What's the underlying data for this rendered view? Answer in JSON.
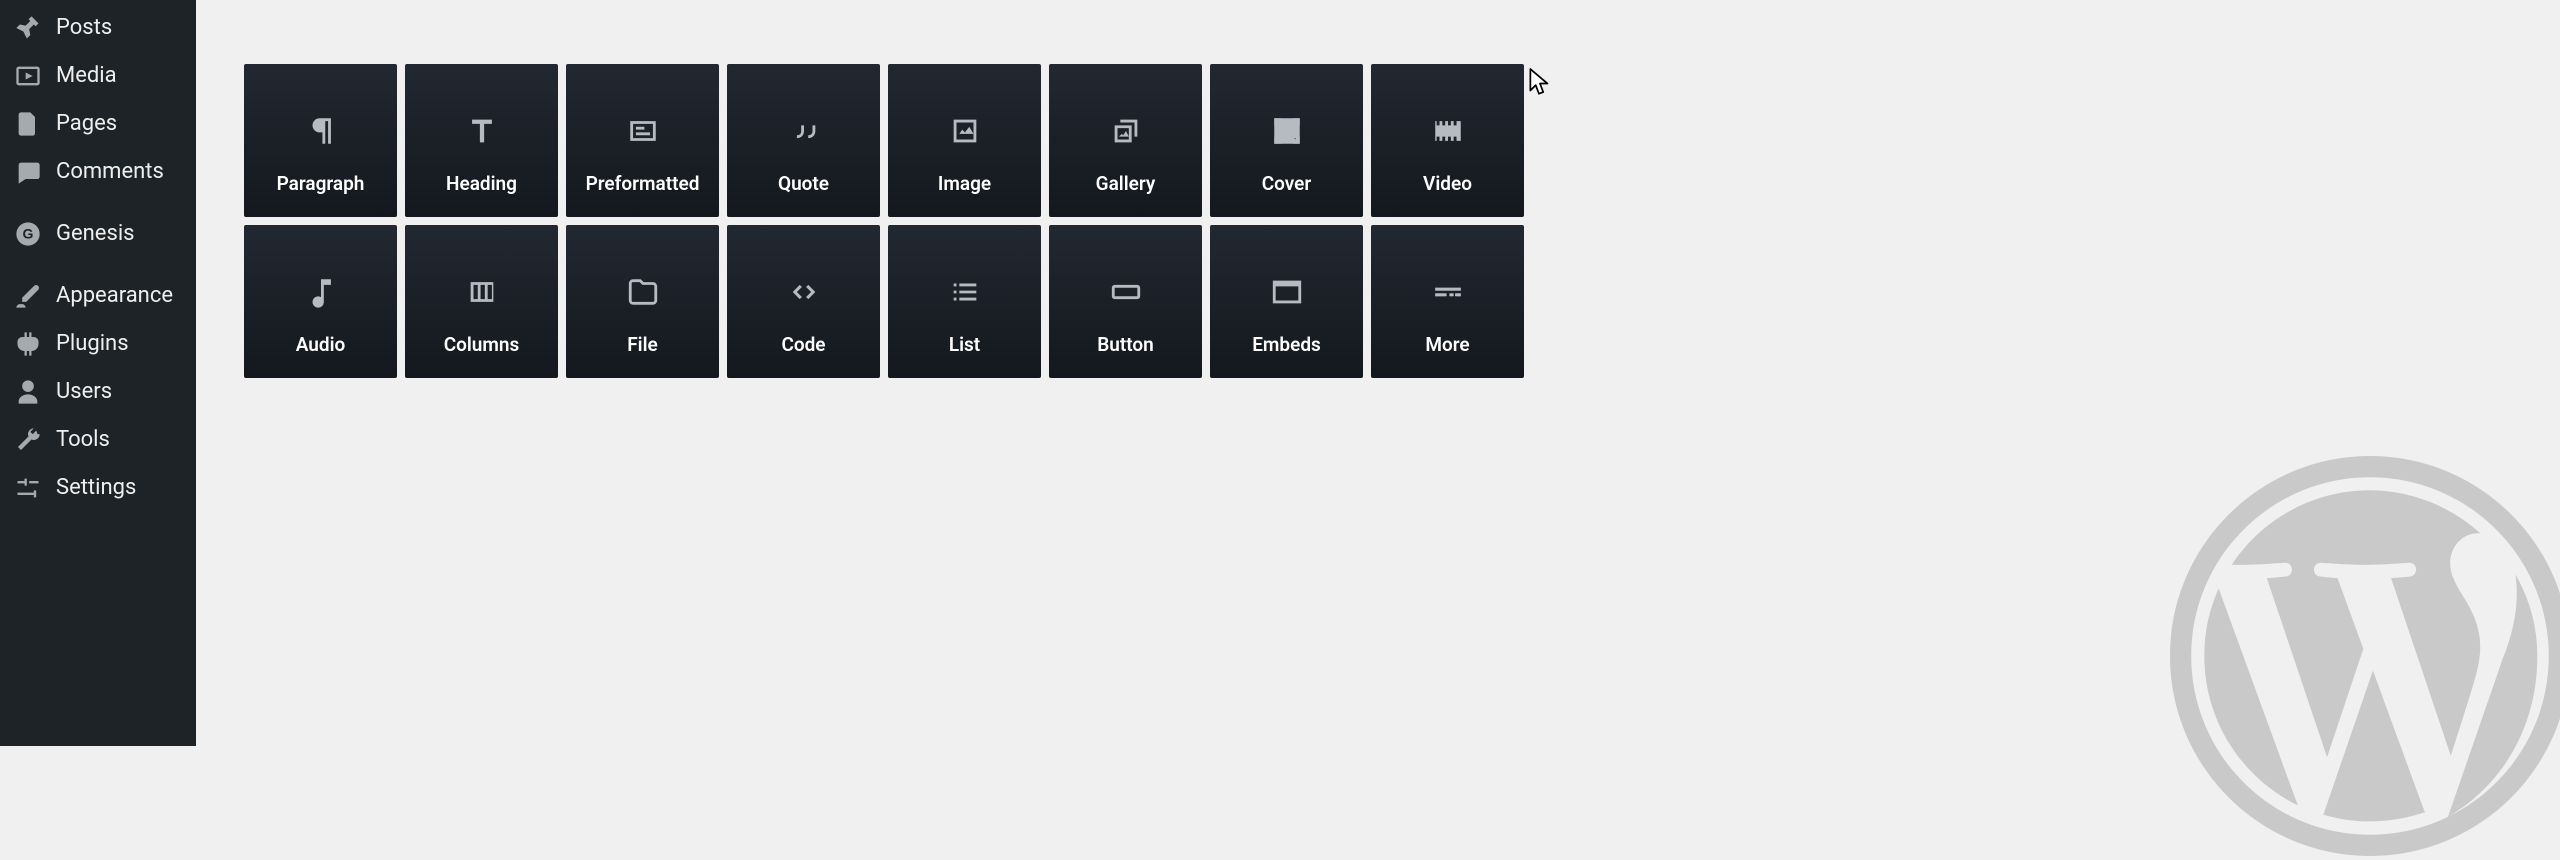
{
  "sidebar": {
    "items": [
      {
        "label": "Posts",
        "icon": "pin"
      },
      {
        "label": "Media",
        "icon": "media"
      },
      {
        "label": "Pages",
        "icon": "page"
      },
      {
        "label": "Comments",
        "icon": "comment"
      },
      {
        "sep": true
      },
      {
        "label": "Genesis",
        "icon": "genesis"
      },
      {
        "sep": true
      },
      {
        "label": "Appearance",
        "icon": "brush"
      },
      {
        "label": "Plugins",
        "icon": "plug"
      },
      {
        "label": "Users",
        "icon": "user"
      },
      {
        "label": "Tools",
        "icon": "wrench"
      },
      {
        "label": "Settings",
        "icon": "sliders"
      }
    ]
  },
  "blocks": [
    {
      "label": "Paragraph",
      "icon": "paragraph"
    },
    {
      "label": "Heading",
      "icon": "heading"
    },
    {
      "label": "Preformatted",
      "icon": "preformatted"
    },
    {
      "label": "Quote",
      "icon": "quote"
    },
    {
      "label": "Image",
      "icon": "image"
    },
    {
      "label": "Gallery",
      "icon": "gallery"
    },
    {
      "label": "Cover",
      "icon": "cover"
    },
    {
      "label": "Video",
      "icon": "video"
    },
    {
      "label": "Audio",
      "icon": "audio"
    },
    {
      "label": "Columns",
      "icon": "columns"
    },
    {
      "label": "File",
      "icon": "file"
    },
    {
      "label": "Code",
      "icon": "code"
    },
    {
      "label": "List",
      "icon": "list"
    },
    {
      "label": "Button",
      "icon": "button"
    },
    {
      "label": "Embeds",
      "icon": "embeds"
    },
    {
      "label": "More",
      "icon": "more"
    }
  ]
}
